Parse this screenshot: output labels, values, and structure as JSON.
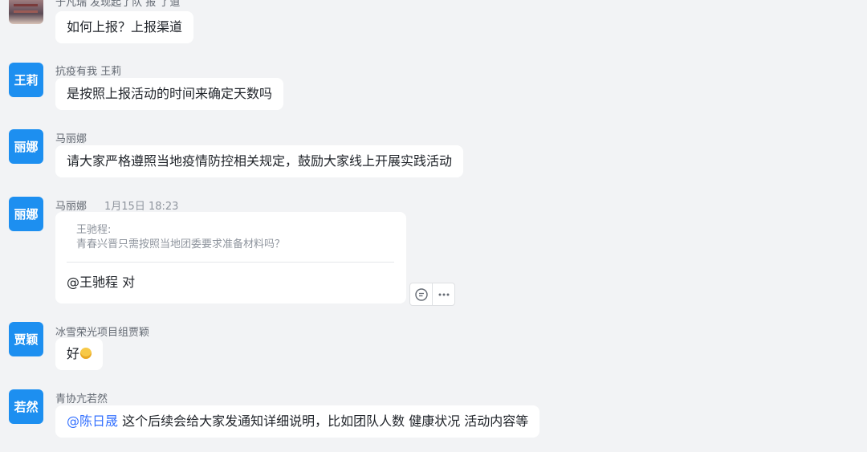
{
  "messages": [
    {
      "sender": "于凡瑞 发现起了队 报 了道",
      "text": "如何上报？上报渠道"
    },
    {
      "avatar": "王莉",
      "sender": "抗疫有我 王莉",
      "text": "是按照上报活动的时间来确定天数吗"
    },
    {
      "avatar": "丽娜",
      "sender": "马丽娜",
      "text": "请大家严格遵照当地疫情防控相关规定，鼓励大家线上开展实践活动"
    },
    {
      "avatar": "丽娜",
      "sender": "马丽娜",
      "time": "1月15日 18:23",
      "quote_name": "王驰程:",
      "quote_text": "青春兴晋只需按照当地团委要求准备材料吗？",
      "text": "@王驰程 对"
    },
    {
      "avatar": "贾颖",
      "sender": "冰雪荣光项目组贾颖",
      "text": "好"
    },
    {
      "avatar": "若然",
      "sender": "青协亢若然",
      "mention": "@陈日晟",
      "text": " 这个后续会给大家发通知详细说明，比如团队人数 健康状况 活动内容等"
    }
  ],
  "actions": {
    "reply_icon": "reply-bubble-icon",
    "more_icon": "more-dots-icon"
  }
}
